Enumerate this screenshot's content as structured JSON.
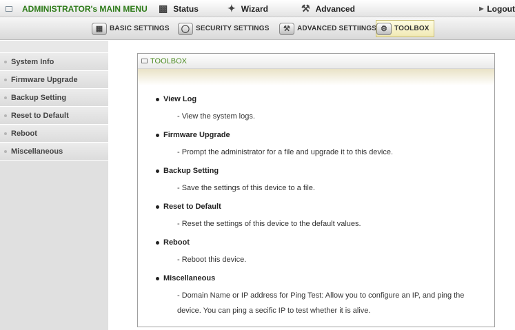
{
  "topbar": {
    "menu_title": "ADMINISTRATOR's MAIN MENU",
    "status": "Status",
    "wizard": "Wizard",
    "advanced": "Advanced",
    "logout": "Logout"
  },
  "tabs": [
    {
      "label": "BASIC SETTINGS",
      "icon": "basic-settings-icon"
    },
    {
      "label": "SECURITY SETTINGS",
      "icon": "security-settings-icon"
    },
    {
      "label": "ADVANCED SETTIINGS",
      "icon": "advanced-settings-icon"
    },
    {
      "label": "TOOLBOX",
      "icon": "toolbox-icon",
      "active": true
    }
  ],
  "sidebar": {
    "items": [
      {
        "label": "System Info"
      },
      {
        "label": "Firmware Upgrade"
      },
      {
        "label": "Backup Setting"
      },
      {
        "label": "Reset to Default"
      },
      {
        "label": "Reboot"
      },
      {
        "label": "Miscellaneous"
      }
    ]
  },
  "panel": {
    "title": "TOOLBOX",
    "entries": [
      {
        "title": "View Log",
        "desc": "- View the system logs."
      },
      {
        "title": "Firmware Upgrade",
        "desc": "- Prompt the administrator for a file and upgrade it to this device."
      },
      {
        "title": "Backup Setting",
        "desc": "- Save the settings of this device to a file."
      },
      {
        "title": "Reset to Default",
        "desc": "- Reset the settings of this device to the default values."
      },
      {
        "title": "Reboot",
        "desc": "- Reboot this device."
      },
      {
        "title": "Miscellaneous",
        "desc": "- Domain Name or IP address for Ping Test: Allow you to configure an IP, and ping the device. You can ping a secific IP to test whether it is alive."
      }
    ]
  },
  "colors": {
    "menu_title": "#2c7a17",
    "panel_title": "#4a8a1e",
    "sidebar_bg": "#e0e0e0",
    "active_tab_bg": "#f0e9b4"
  }
}
